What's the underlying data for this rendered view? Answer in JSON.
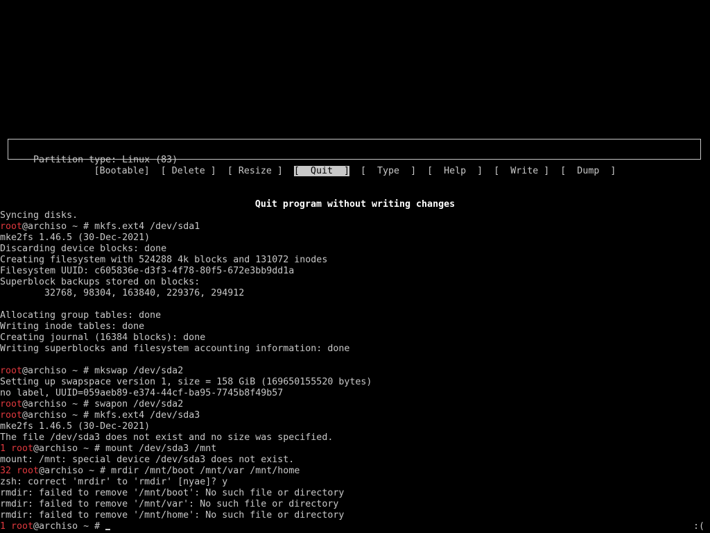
{
  "cfdisk": {
    "info_text": "Partition type: Linux (83)",
    "menu": [
      {
        "label": "Bootable",
        "selected": false
      },
      {
        "label": " Delete ",
        "selected": false
      },
      {
        "label": " Resize ",
        "selected": false
      },
      {
        "label": "  Quit  ",
        "selected": true
      },
      {
        "label": "  Type  ",
        "selected": false
      },
      {
        "label": "  Help  ",
        "selected": false
      },
      {
        "label": "  Write ",
        "selected": false
      },
      {
        "label": "  Dump  ",
        "selected": false
      }
    ],
    "help_text": "Quit program without writing changes"
  },
  "console": {
    "lines": [
      {
        "type": "out",
        "text": "Syncing disks."
      },
      {
        "type": "cmd",
        "status": "",
        "user": "root",
        "host": "@archiso ~ # ",
        "command": "mkfs.ext4 /dev/sda1"
      },
      {
        "type": "out",
        "text": "mke2fs 1.46.5 (30-Dec-2021)"
      },
      {
        "type": "out",
        "text": "Discarding device blocks: done"
      },
      {
        "type": "out",
        "text": "Creating filesystem with 524288 4k blocks and 131072 inodes"
      },
      {
        "type": "out",
        "text": "Filesystem UUID: c605836e-d3f3-4f78-80f5-672e3bb9dd1a"
      },
      {
        "type": "out",
        "text": "Superblock backups stored on blocks:"
      },
      {
        "type": "out",
        "text": "        32768, 98304, 163840, 229376, 294912"
      },
      {
        "type": "out",
        "text": ""
      },
      {
        "type": "out",
        "text": "Allocating group tables: done"
      },
      {
        "type": "out",
        "text": "Writing inode tables: done"
      },
      {
        "type": "out",
        "text": "Creating journal (16384 blocks): done"
      },
      {
        "type": "out",
        "text": "Writing superblocks and filesystem accounting information: done"
      },
      {
        "type": "out",
        "text": ""
      },
      {
        "type": "cmd",
        "status": "",
        "user": "root",
        "host": "@archiso ~ # ",
        "command": "mkswap /dev/sda2"
      },
      {
        "type": "out",
        "text": "Setting up swapspace version 1, size = 158 GiB (169650155520 bytes)"
      },
      {
        "type": "out",
        "text": "no label, UUID=059aeb89-e374-44cf-ba95-7745b8f49b57"
      },
      {
        "type": "cmd",
        "status": "",
        "user": "root",
        "host": "@archiso ~ # ",
        "command": "swapon /dev/sda2"
      },
      {
        "type": "cmd",
        "status": "",
        "user": "root",
        "host": "@archiso ~ # ",
        "command": "mkfs.ext4 /dev/sda3"
      },
      {
        "type": "out",
        "text": "mke2fs 1.46.5 (30-Dec-2021)"
      },
      {
        "type": "out",
        "text": "The file /dev/sda3 does not exist and no size was specified."
      },
      {
        "type": "cmd",
        "status": "1 ",
        "user": "root",
        "host": "@archiso ~ # ",
        "command": "mount /dev/sda3 /mnt"
      },
      {
        "type": "out",
        "text": "mount: /mnt: special device /dev/sda3 does not exist."
      },
      {
        "type": "cmd",
        "status": "32 ",
        "user": "root",
        "host": "@archiso ~ # ",
        "command": "mrdir /mnt/boot /mnt/var /mnt/home"
      },
      {
        "type": "out",
        "text": "zsh: correct 'mrdir' to 'rmdir' [nyae]? y"
      },
      {
        "type": "out",
        "text": "rmdir: failed to remove '/mnt/boot': No such file or directory"
      },
      {
        "type": "out",
        "text": "rmdir: failed to remove '/mnt/var': No such file or directory"
      },
      {
        "type": "out",
        "text": "rmdir: failed to remove '/mnt/home': No such file or directory"
      },
      {
        "type": "cmd",
        "status": "1 ",
        "user": "root",
        "host": "@archiso ~ # ",
        "command": "",
        "active": true
      }
    ],
    "right_prompt": ":("
  },
  "colors": {
    "background": "#000000",
    "foreground": "#c8c8c8",
    "prompt_red": "#e0393e",
    "highlight": "#c8c8c8"
  }
}
